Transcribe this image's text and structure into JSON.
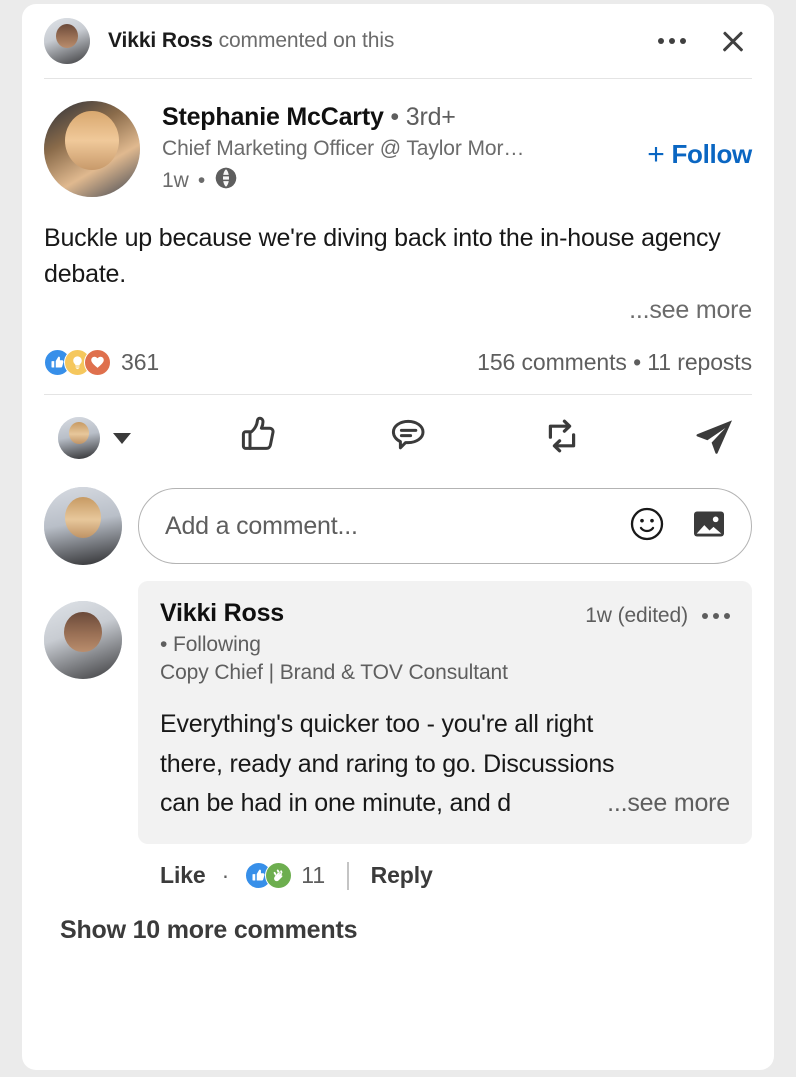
{
  "notification": {
    "actor": "Vikki Ross",
    "text": " commented on this",
    "avatar_icon": "avatar-vikki-ross",
    "more_icon": "ellipsis-icon",
    "close_icon": "close-icon"
  },
  "post": {
    "author": {
      "name": "Stephanie McCarty",
      "separator": "•",
      "degree": "3rd+",
      "headline": "Chief Marketing Officer @ Taylor Mor…",
      "time": "1w",
      "visibility_icon": "globe-icon",
      "avatar_icon": "avatar-stephanie-mccarty"
    },
    "follow": {
      "plus": "+",
      "label": "Follow",
      "color": "#0a66c2"
    },
    "body_text": "Buckle up because we're diving back into the in-house agency debate.",
    "see_more": "...see more",
    "social": {
      "reactions": [
        {
          "name": "like",
          "color": "#378fe9"
        },
        {
          "name": "insightful",
          "color": "#f5c75d"
        },
        {
          "name": "love",
          "color": "#df704d"
        }
      ],
      "reaction_count": "361",
      "comments_reposts": "156 comments • 11 reposts"
    },
    "actions": [
      {
        "name": "react-as",
        "icon": "avatar-with-chevron-icon"
      },
      {
        "name": "like",
        "icon": "thumbs-up-icon"
      },
      {
        "name": "comment",
        "icon": "comment-bubble-icon"
      },
      {
        "name": "repost",
        "icon": "repost-icon"
      },
      {
        "name": "send",
        "icon": "send-icon"
      }
    ]
  },
  "comment_input": {
    "placeholder": "Add a comment...",
    "avatar_icon": "avatar-current-user",
    "emoji_icon": "emoji-icon",
    "image_icon": "image-icon"
  },
  "comments": [
    {
      "author": "Vikki Ross",
      "time": "1w (edited)",
      "following": "• Following",
      "headline": "Copy Chief | Brand & TOV Consultant",
      "text_line1": "Everything's quicker too - you're all right",
      "text_line2": "there, ready and raring to go. Discussions",
      "text_line3": "can be had in one minute, and d",
      "see_more": "...see more",
      "like_label": "Like",
      "mid_dot": "·",
      "reactions": [
        {
          "name": "like",
          "color": "#378fe9"
        },
        {
          "name": "celebrate",
          "color": "#6dae4f"
        }
      ],
      "reaction_count": "11",
      "reply_label": "Reply",
      "more_icon": "ellipsis-icon",
      "avatar_icon": "avatar-vikki-ross"
    }
  ],
  "show_more_comments": "Show 10 more comments"
}
